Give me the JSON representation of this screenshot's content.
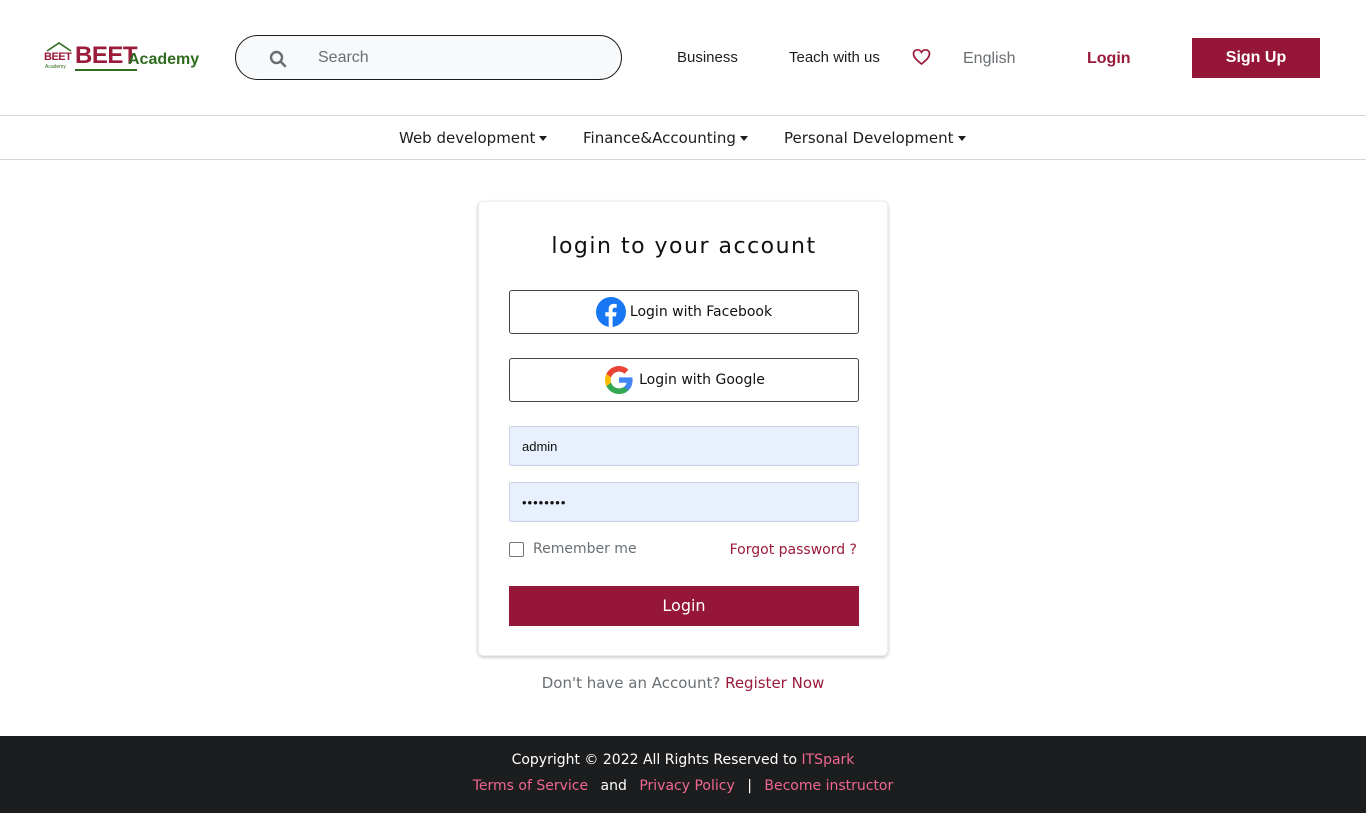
{
  "header": {
    "logo": {
      "small_text": "BEET",
      "small_sub": "Academy",
      "big_text": "BEET",
      "big_sub": "Academy"
    },
    "search": {
      "placeholder": "Search",
      "icon": "search-icon"
    },
    "nav": {
      "business": "Business",
      "teach": "Teach with us",
      "wishlist_icon": "heart-icon",
      "language": "English",
      "login": "Login",
      "signup": "Sign Up"
    }
  },
  "categories": [
    {
      "label": "Web development"
    },
    {
      "label": "Finance&Accounting"
    },
    {
      "label": "Personal Development"
    }
  ],
  "login_card": {
    "title": "login to your account",
    "facebook_label": "Login with Facebook",
    "google_label": "Login with Google",
    "username_value": "admin",
    "password_value": "••••••••",
    "remember_label": "Remember me",
    "forgot_label": "Forgot password ?",
    "submit_label": "Login"
  },
  "register": {
    "prompt": "Don't have an Account?",
    "link": "Register Now"
  },
  "footer": {
    "copyright_prefix": "Copyright © 2022 All Rights Reserved to",
    "brand": "ITSpark",
    "terms": "Terms of Service",
    "and": "and",
    "privacy": "Privacy Policy",
    "separator": "|",
    "instructor": "Become instructor"
  },
  "colors": {
    "brand": "#951639",
    "link_pink": "#f1678e",
    "footer_bg": "#1c1d1f",
    "logo_green": "#2e6b1f"
  }
}
